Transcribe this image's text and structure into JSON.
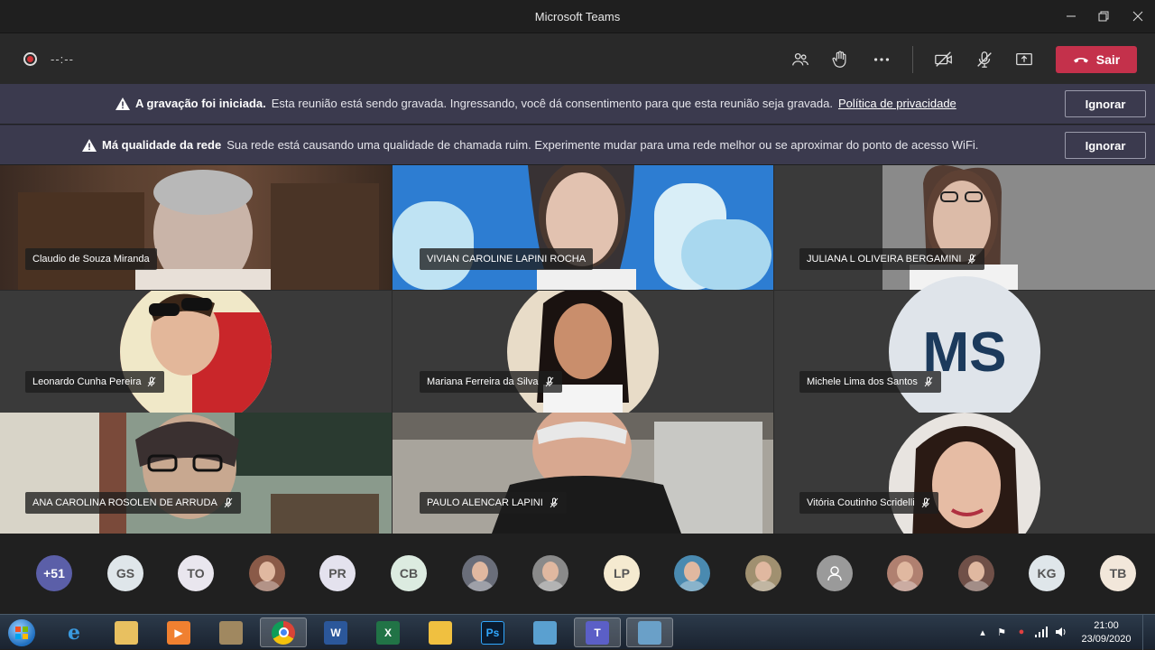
{
  "window": {
    "title": "Microsoft Teams"
  },
  "toolbar": {
    "timer": "--:--",
    "leave_label": "Sair"
  },
  "banners": [
    {
      "title": "A gravação foi iniciada.",
      "text": "Esta reunião está sendo gravada. Ingressando, você dá consentimento para que esta reunião seja gravada.",
      "link": "Política de privacidade",
      "button": "Ignorar"
    },
    {
      "title": "Má qualidade da rede",
      "text": "Sua rede está causando uma qualidade de chamada ruim. Experimente mudar para uma rede melhor ou se aproximar do ponto de acesso WiFi.",
      "button": "Ignorar"
    }
  ],
  "tiles": [
    {
      "name": "Claudio de Souza Miranda",
      "muted": false
    },
    {
      "name": "VIVIAN CAROLINE LAPINI ROCHA",
      "muted": false
    },
    {
      "name": "JULIANA L OLIVEIRA BERGAMINI",
      "muted": true
    },
    {
      "name": "Leonardo Cunha Pereira",
      "muted": true
    },
    {
      "name": "Mariana Ferreira da Silva",
      "muted": true
    },
    {
      "name": "Michele Lima dos Santos",
      "muted": true,
      "initials": "MS"
    },
    {
      "name": "ANA CAROLINA ROSOLEN DE ARRUDA",
      "muted": true
    },
    {
      "name": "PAULO ALENCAR LAPINI",
      "muted": true
    },
    {
      "name": "Vitória Coutinho Scridelli",
      "muted": true
    }
  ],
  "participants": [
    {
      "label": "+51",
      "bg": "#5b5fa8",
      "fg": "#ffffff"
    },
    {
      "label": "GS",
      "bg": "#dfe6ea",
      "fg": "#555555"
    },
    {
      "label": "TO",
      "bg": "#e9e6ee",
      "fg": "#555555"
    },
    {
      "label": "",
      "bg": "#8a5a48",
      "fg": "#ffffff",
      "photo": true
    },
    {
      "label": "PR",
      "bg": "#e4e2ee",
      "fg": "#555555"
    },
    {
      "label": "CB",
      "bg": "#dcebe0",
      "fg": "#555555"
    },
    {
      "label": "",
      "bg": "#6a6e7a",
      "fg": "#ffffff",
      "photo": true
    },
    {
      "label": "",
      "bg": "#8a8a8a",
      "fg": "#ffffff",
      "photo": true
    },
    {
      "label": "LP",
      "bg": "#f5ead0",
      "fg": "#555555"
    },
    {
      "label": "",
      "bg": "#4a8ab0",
      "fg": "#ffffff",
      "photo": true
    },
    {
      "label": "",
      "bg": "#a09070",
      "fg": "#ffffff",
      "photo": true
    },
    {
      "label": "",
      "bg": "#9a9a9a",
      "fg": "#ffffff",
      "generic": true
    },
    {
      "label": "",
      "bg": "#b08070",
      "fg": "#ffffff",
      "photo": true
    },
    {
      "label": "",
      "bg": "#705048",
      "fg": "#ffffff",
      "photo": true
    },
    {
      "label": "KG",
      "bg": "#dfe6ea",
      "fg": "#555555"
    },
    {
      "label": "TB",
      "bg": "#f2e7da",
      "fg": "#555555"
    }
  ],
  "taskbar": {
    "time": "21:00",
    "date": "23/09/2020"
  },
  "colors": {
    "leave": "#c4314b",
    "banner": "#3b3a4e",
    "accent": "#5b5fa8"
  }
}
